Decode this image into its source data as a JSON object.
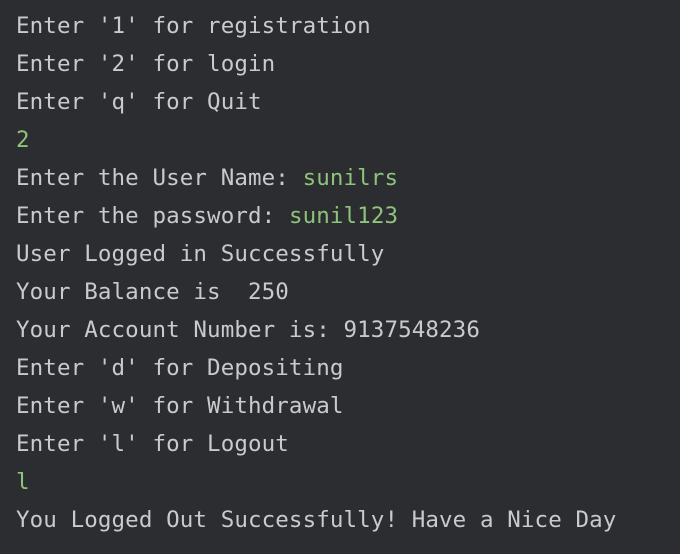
{
  "console": {
    "colors": {
      "background": "#2b2d30",
      "output_text": "#c8cace",
      "user_input": "#8fc27a"
    },
    "lines": [
      {
        "output": "Enter '1' for registration",
        "input": ""
      },
      {
        "output": "Enter '2' for login",
        "input": ""
      },
      {
        "output": "Enter 'q' for Quit",
        "input": ""
      },
      {
        "output": "",
        "input": "2"
      },
      {
        "output": "Enter the User Name: ",
        "input": "sunilrs"
      },
      {
        "output": "Enter the password: ",
        "input": "sunil123"
      },
      {
        "output": "User Logged in Successfully",
        "input": ""
      },
      {
        "output": "Your Balance is  250",
        "input": ""
      },
      {
        "output": "Your Account Number is: 9137548236",
        "input": ""
      },
      {
        "output": "Enter 'd' for Depositing",
        "input": ""
      },
      {
        "output": "Enter 'w' for Withdrawal",
        "input": ""
      },
      {
        "output": "Enter 'l' for Logout",
        "input": ""
      },
      {
        "output": "",
        "input": "l"
      },
      {
        "output": "You Logged Out Successfully! Have a Nice Day",
        "input": ""
      }
    ]
  }
}
